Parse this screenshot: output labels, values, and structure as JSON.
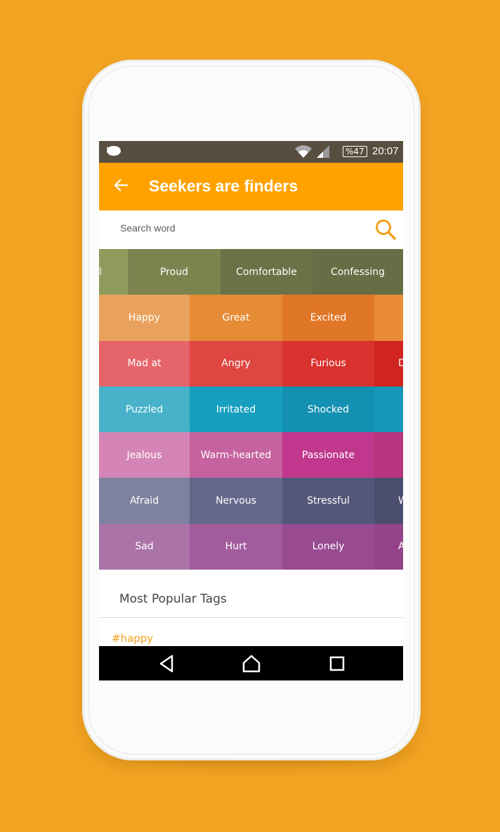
{
  "colors": {
    "background": "#f4a523",
    "accent": "#ffa200",
    "status_bar": "#574e40",
    "tag": "#f2a11d"
  },
  "status_bar": {
    "battery": "%47",
    "time": "20:07",
    "icons": [
      "message-bubble-icon",
      "wifi-icon",
      "signal-icon",
      "battery-icon"
    ]
  },
  "appbar": {
    "title": "Seekers are finders",
    "back_icon": "arrow-left-icon"
  },
  "search": {
    "placeholder": "Search word",
    "value": "",
    "icon": "search-icon"
  },
  "emotion_rows": [
    {
      "layout": "shift",
      "cells": [
        {
          "label": "l",
          "color": "#8f9a5d"
        },
        {
          "label": "Proud",
          "color": "#7b844f"
        },
        {
          "label": "Comfortable",
          "color": "#6b7247"
        },
        {
          "label": "Confessing",
          "color": "#676d44"
        }
      ]
    },
    {
      "layout": "std",
      "cells": [
        {
          "label": "Happy",
          "color": "#e9a25d"
        },
        {
          "label": "Great",
          "color": "#e68b36"
        },
        {
          "label": "Excited",
          "color": "#e07727"
        },
        {
          "label": "",
          "color": "#e88b34"
        }
      ]
    },
    {
      "layout": "std",
      "cells": [
        {
          "label": "Mad at",
          "color": "#e5646a"
        },
        {
          "label": "Angry",
          "color": "#df4541"
        },
        {
          "label": "Furious",
          "color": "#d9322e"
        },
        {
          "label": "D",
          "color": "#d12420"
        }
      ]
    },
    {
      "layout": "std",
      "cells": [
        {
          "label": "Puzzled",
          "color": "#47b2ca"
        },
        {
          "label": "Irritated",
          "color": "#169fbf"
        },
        {
          "label": "Shocked",
          "color": "#1491b2"
        },
        {
          "label": "",
          "color": "#1597ba"
        }
      ]
    },
    {
      "layout": "std",
      "cells": [
        {
          "label": "Jealous",
          "color": "#d585b5"
        },
        {
          "label": "Warm-hearted",
          "color": "#c5629f"
        },
        {
          "label": "Passionate",
          "color": "#c1378d"
        },
        {
          "label": "",
          "color": "#b8347f"
        }
      ]
    },
    {
      "layout": "std",
      "cells": [
        {
          "label": "Afraid",
          "color": "#7f829f"
        },
        {
          "label": "Nervous",
          "color": "#64678a"
        },
        {
          "label": "Stressful",
          "color": "#535779"
        },
        {
          "label": "W",
          "color": "#4a4d6e"
        }
      ]
    },
    {
      "layout": "std",
      "cells": [
        {
          "label": "Sad",
          "color": "#aa74a9"
        },
        {
          "label": "Hurt",
          "color": "#a25b9d"
        },
        {
          "label": "Lonely",
          "color": "#984b91"
        },
        {
          "label": "A",
          "color": "#944389"
        }
      ]
    }
  ],
  "popular": {
    "heading": "Most Popular Tags",
    "tags": [
      "#happy"
    ]
  },
  "nav_bar": {
    "icons": [
      "back-triangle-icon",
      "home-icon",
      "recents-square-icon"
    ]
  }
}
